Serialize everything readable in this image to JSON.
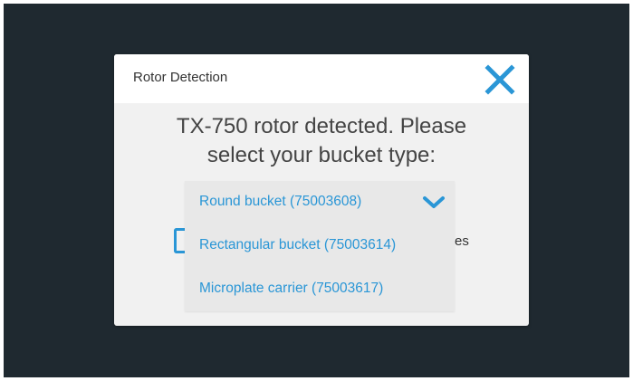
{
  "dialog": {
    "title": "Rotor Detection",
    "prompt_line1": "TX-750 rotor detected. Please",
    "prompt_line2": "select your bucket type:",
    "obscured_option_text": "es"
  },
  "dropdown": {
    "options": [
      {
        "label": "Round bucket (75003608)",
        "selected": true
      },
      {
        "label": "Rectangular bucket (75003614)",
        "selected": false
      },
      {
        "label": "Microplate carrier (75003617)",
        "selected": false
      }
    ]
  },
  "colors": {
    "accent": "#2a96d6",
    "background": "#1f2930",
    "dialog_bg": "#f1f1f1",
    "dropdown_bg": "#e8e8e8"
  },
  "icons": {
    "close": "close-icon",
    "expand": "chevron-down-icon"
  }
}
